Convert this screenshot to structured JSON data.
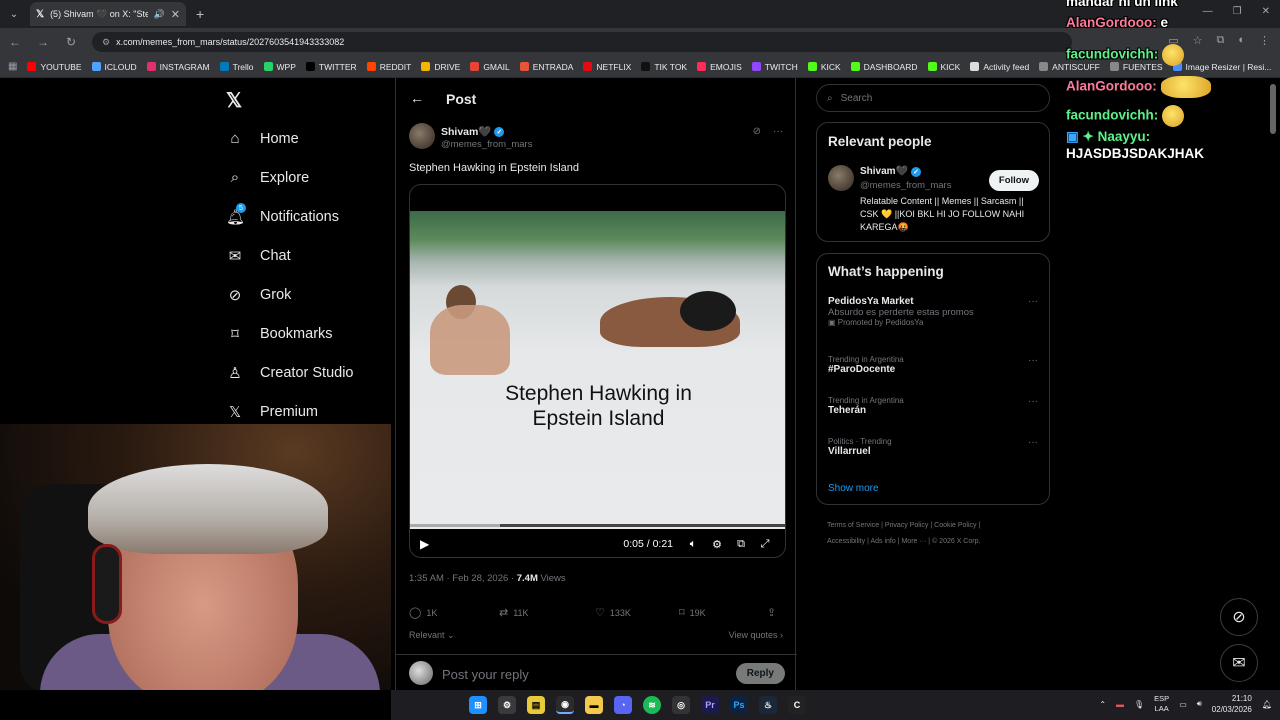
{
  "browser": {
    "tab_title": "(5) Shivam 🖤 on X: \"Steph",
    "url": "x.com/memes_from_mars/status/2027603541943333082",
    "bookmarks": [
      {
        "label": "YOUTUBE",
        "color": "#ff0000"
      },
      {
        "label": "ICLOUD",
        "color": "#4fa3ff"
      },
      {
        "label": "INSTAGRAM",
        "color": "#e1306c"
      },
      {
        "label": "Trello",
        "color": "#0079bf"
      },
      {
        "label": "WPP",
        "color": "#25d366"
      },
      {
        "label": "TWITTER",
        "color": "#000000"
      },
      {
        "label": "REDDIT",
        "color": "#ff4500"
      },
      {
        "label": "DRIVE",
        "color": "#f4b400"
      },
      {
        "label": "GMAIL",
        "color": "#ea4335"
      },
      {
        "label": "ENTRADA",
        "color": "#e8543a"
      },
      {
        "label": "NETFLIX",
        "color": "#e50914"
      },
      {
        "label": "TIK TOK",
        "color": "#111111"
      },
      {
        "label": "EMOJIS",
        "color": "#ff2d55"
      },
      {
        "label": "TWITCH",
        "color": "#9146ff"
      },
      {
        "label": "KICK",
        "color": "#53fc18"
      },
      {
        "label": "DASHBOARD",
        "color": "#53fc18"
      },
      {
        "label": "KICK",
        "color": "#53fc18"
      },
      {
        "label": "Activity feed",
        "color": "#dddddd"
      },
      {
        "label": "ANTISCUFF",
        "color": "#888888"
      },
      {
        "label": "FUENTES",
        "color": "#888888"
      },
      {
        "label": "Image Resizer | Resi...",
        "color": "#4a8cff"
      }
    ]
  },
  "nav": {
    "items": [
      {
        "label": "Home",
        "icon": "home-icon"
      },
      {
        "label": "Explore",
        "icon": "search-icon"
      },
      {
        "label": "Notifications",
        "icon": "bell-icon"
      },
      {
        "label": "Chat",
        "icon": "mail-icon"
      },
      {
        "label": "Grok",
        "icon": "grok-icon"
      },
      {
        "label": "Bookmarks",
        "icon": "bookmark-icon"
      },
      {
        "label": "Creator Studio",
        "icon": "creator-icon"
      },
      {
        "label": "Premium",
        "icon": "x-premium-icon"
      }
    ],
    "notif_badge": "5"
  },
  "post": {
    "header_title": "Post",
    "author_name": "Shivam🖤",
    "author_handle": "@memes_from_mars",
    "text": "Stephen Hawking in Epstein Island",
    "video_caption_line1": "Stephen Hawking in",
    "video_caption_line2": "Epstein Island",
    "video_time": "0:05 / 0:21",
    "video_progress": 0.24,
    "time": "1:35 AM · Feb 28, 2026 · ",
    "views_count": "7.4M",
    "views_label": " Views",
    "replies": "1K",
    "reposts": "11K",
    "likes": "133K",
    "bookmarks": "19K",
    "relevant_label": "Relevant ⌄",
    "view_quotes": "View quotes ›",
    "reply_placeholder": "Post your reply",
    "reply_button": "Reply"
  },
  "sidebar": {
    "search_placeholder": "Search",
    "relevant_people_title": "Relevant people",
    "person_name": "Shivam🖤",
    "person_handle": "@memes_from_mars",
    "follow_label": "Follow",
    "person_bio": "Relatable Content || Memes || Sarcasm || CSK 💛 ||KOI BKL HI JO FOLLOW NAHI KAREGA🤬",
    "happening_title": "What’s happening",
    "trends": [
      {
        "context": "",
        "name": "PedidosYa Market",
        "sub": "Absurdo es perderte estas promos",
        "extra": "Promoted by PedidosYa"
      },
      {
        "context": "Trending in Argentina",
        "name": "#ParoDocente",
        "sub": "",
        "extra": ""
      },
      {
        "context": "Trending in Argentina",
        "name": "Teherán",
        "sub": "",
        "extra": ""
      },
      {
        "context": "Politics · Trending",
        "name": "Villarruel",
        "sub": "",
        "extra": ""
      }
    ],
    "show_more": "Show more",
    "footer": [
      "Terms of Service",
      "Privacy Policy",
      "Cookie Policy",
      "Accessibility",
      "Ads info",
      "More ···",
      "© 2026 X Corp."
    ]
  },
  "chat": {
    "top_line": "mandar ni un link",
    "lines": [
      {
        "user": "AlanGordooo:",
        "msg": " e",
        "emote": false
      },
      {
        "user": "facundovichh:",
        "msg": "",
        "emote": true
      },
      {
        "user": "AlanGordooo:",
        "msg": "",
        "emote": true
      },
      {
        "user": "facundovichh:",
        "msg": "",
        "emote": true
      }
    ],
    "last_user": "✦ Naayyu:",
    "last_msg": "HJASDBJSDAKJHAK"
  },
  "taskbar": {
    "lang_top": "ESP",
    "lang_bottom": "LAA",
    "time": "21:10",
    "date": "02/03/2026"
  }
}
